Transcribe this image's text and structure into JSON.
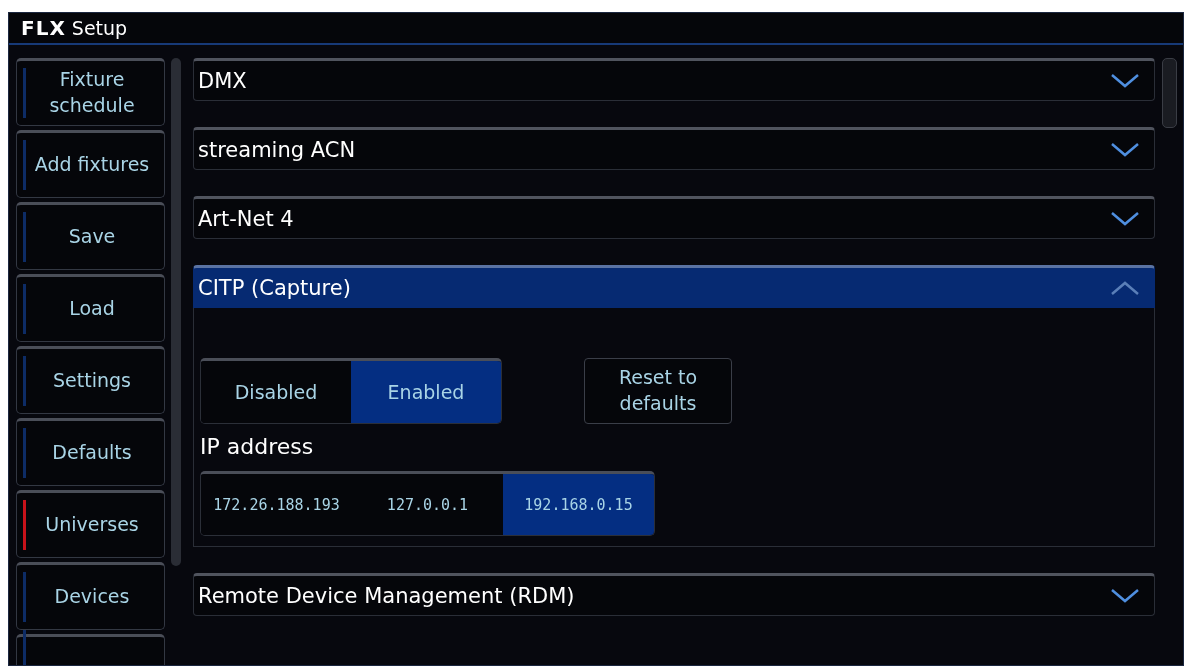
{
  "window": {
    "logo": "FLX",
    "title": "Setup"
  },
  "sidebar": {
    "items": [
      {
        "label": "Fixture schedule",
        "selected": false
      },
      {
        "label": "Add fixtures",
        "selected": false
      },
      {
        "label": "Save",
        "selected": false
      },
      {
        "label": "Load",
        "selected": false
      },
      {
        "label": "Settings",
        "selected": false
      },
      {
        "label": "Defaults",
        "selected": false
      },
      {
        "label": "Universes",
        "selected": true
      },
      {
        "label": "Devices",
        "selected": false
      }
    ]
  },
  "sections": [
    {
      "title": "DMX",
      "expanded": false
    },
    {
      "title": "streaming ACN",
      "expanded": false
    },
    {
      "title": "Art-Net 4",
      "expanded": false
    },
    {
      "title": "CITP (Capture)",
      "expanded": true,
      "mode_options": [
        {
          "label": "Disabled",
          "selected": false
        },
        {
          "label": "Enabled",
          "selected": true
        }
      ],
      "reset_button": "Reset to defaults",
      "ip_label": "IP address",
      "ip_options": [
        {
          "label": "172.26.188.193",
          "selected": false
        },
        {
          "label": "127.0.0.1",
          "selected": false
        },
        {
          "label": "192.168.0.15",
          "selected": true
        }
      ]
    },
    {
      "title": "Remote Device Management (RDM)",
      "expanded": false
    }
  ]
}
